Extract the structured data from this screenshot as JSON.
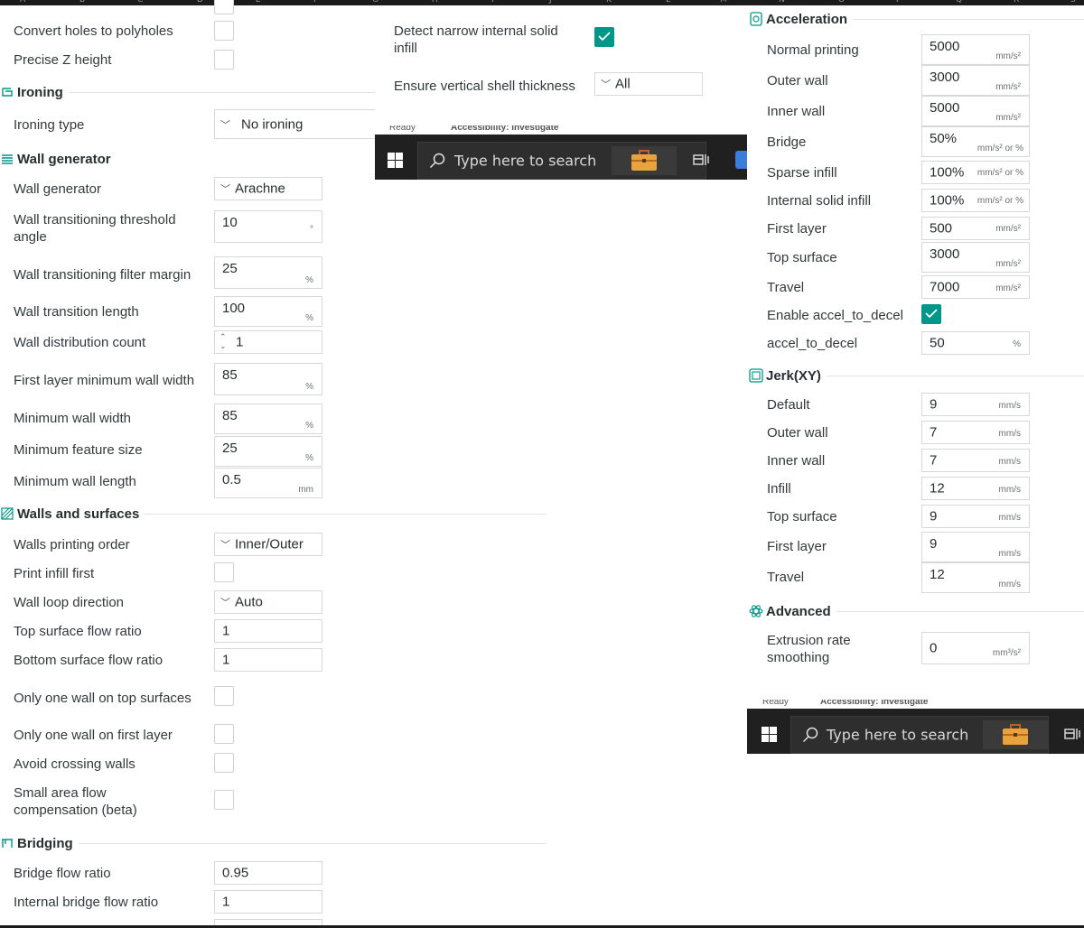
{
  "spreadsheet_columns": [
    "A",
    "B",
    "C",
    "D",
    "E",
    "F",
    "G",
    "H",
    "I",
    "J",
    "K",
    "L",
    "M",
    "N",
    "O",
    "P",
    "Q",
    "R",
    "S"
  ],
  "left_panel": {
    "top_rows": [
      {
        "label": "Convert holes to polyholes",
        "checked": false
      },
      {
        "label": "Precise Z height",
        "checked": false
      }
    ],
    "ironing": {
      "title": "Ironing",
      "icon": "ironing-icon",
      "type_label": "Ironing type",
      "type_value": "No ironing"
    },
    "wall_generator": {
      "title": "Wall generator",
      "icon": "wall-generator-icon",
      "rows": [
        {
          "label": "Wall generator",
          "value": "Arachne"
        },
        {
          "label": "Wall transitioning threshold angle",
          "value": "10",
          "unit": "°"
        },
        {
          "label": "Wall transitioning filter margin",
          "value": "25",
          "unit": "%"
        },
        {
          "label": "Wall transition length",
          "value": "100",
          "unit": "%"
        },
        {
          "label": "Wall distribution count",
          "value": "1"
        },
        {
          "label": "First layer minimum wall width",
          "value": "85",
          "unit": "%"
        },
        {
          "label": "Minimum wall width",
          "value": "85",
          "unit": "%"
        },
        {
          "label": "Minimum feature size",
          "value": "25",
          "unit": "%"
        },
        {
          "label": "Minimum wall length",
          "value": "0.5",
          "unit": "mm"
        }
      ]
    },
    "walls_surfaces": {
      "title": "Walls and surfaces",
      "icon": "walls-surfaces-icon",
      "rows": [
        {
          "label": "Walls printing order",
          "value": "Inner/Outer"
        },
        {
          "label": "Print infill first",
          "checked": false
        },
        {
          "label": "Wall loop direction",
          "value": "Auto"
        },
        {
          "label": "Top surface flow ratio",
          "value": "1"
        },
        {
          "label": "Bottom surface flow ratio",
          "value": "1"
        },
        {
          "label": "Only one wall on top surfaces",
          "checked": false
        },
        {
          "label": "Only one wall on first layer",
          "checked": false
        },
        {
          "label": "Avoid crossing walls",
          "checked": false
        },
        {
          "label": "Small area flow compensation (beta)",
          "checked": false
        }
      ]
    },
    "bridging": {
      "title": "Bridging",
      "icon": "bridging-icon",
      "rows": [
        {
          "label": "Bridge flow ratio",
          "value": "0.95"
        },
        {
          "label": "Internal bridge flow ratio",
          "value": "1"
        }
      ]
    }
  },
  "middle_panel": {
    "detect_label": "Detect narrow internal solid infill",
    "detect_checked": true,
    "ensure_label": "Ensure vertical shell thickness",
    "ensure_value": "All"
  },
  "right_panel": {
    "acceleration": {
      "title": "Acceleration",
      "icon": "acceleration-icon",
      "rows": [
        {
          "label": "Normal printing",
          "value": "5000",
          "unit": "mm/s²"
        },
        {
          "label": "Outer wall",
          "value": "3000",
          "unit": "mm/s²"
        },
        {
          "label": "Inner wall",
          "value": "5000",
          "unit": "mm/s²"
        },
        {
          "label": "Bridge",
          "value": "50%",
          "unit": "mm/s² or %"
        },
        {
          "label": "Sparse infill",
          "value": "100%",
          "unit": "mm/s² or %"
        },
        {
          "label": "Internal solid infill",
          "value": "100%",
          "unit": "mm/s² or %"
        },
        {
          "label": "First layer",
          "value": "500",
          "unit": "mm/s²"
        },
        {
          "label": "Top surface",
          "value": "3000",
          "unit": "mm/s²"
        },
        {
          "label": "Travel",
          "value": "7000",
          "unit": "mm/s²"
        },
        {
          "label": "Enable accel_to_decel",
          "checked": true
        },
        {
          "label": "accel_to_decel",
          "value": "50",
          "unit": "%"
        }
      ]
    },
    "jerk": {
      "title": "Jerk(XY)",
      "icon": "jerk-icon",
      "rows": [
        {
          "label": "Default",
          "value": "9",
          "unit": "mm/s"
        },
        {
          "label": "Outer wall",
          "value": "7",
          "unit": "mm/s"
        },
        {
          "label": "Inner wall",
          "value": "7",
          "unit": "mm/s"
        },
        {
          "label": "Infill",
          "value": "12",
          "unit": "mm/s"
        },
        {
          "label": "Top surface",
          "value": "9",
          "unit": "mm/s"
        },
        {
          "label": "First layer",
          "value": "9",
          "unit": "mm/s"
        },
        {
          "label": "Travel",
          "value": "12",
          "unit": "mm/s"
        }
      ]
    },
    "advanced": {
      "title": "Advanced",
      "icon": "advanced-icon",
      "rows": [
        {
          "label": "Extrusion rate smoothing",
          "value": "0",
          "unit": "mm³/s²"
        }
      ]
    }
  },
  "taskbar": {
    "status_ready": "Ready",
    "status_accessibility": "Accessibility: Investigate",
    "search_placeholder": "Type here to search",
    "start_icon": "windows-start-icon",
    "search_icon": "search-icon",
    "app_icon": "briefcase-icon",
    "taskview_icon": "task-view-icon"
  },
  "colors": {
    "accent": "#009688",
    "taskbar_bg": "#202020",
    "text": "#323a3c"
  }
}
